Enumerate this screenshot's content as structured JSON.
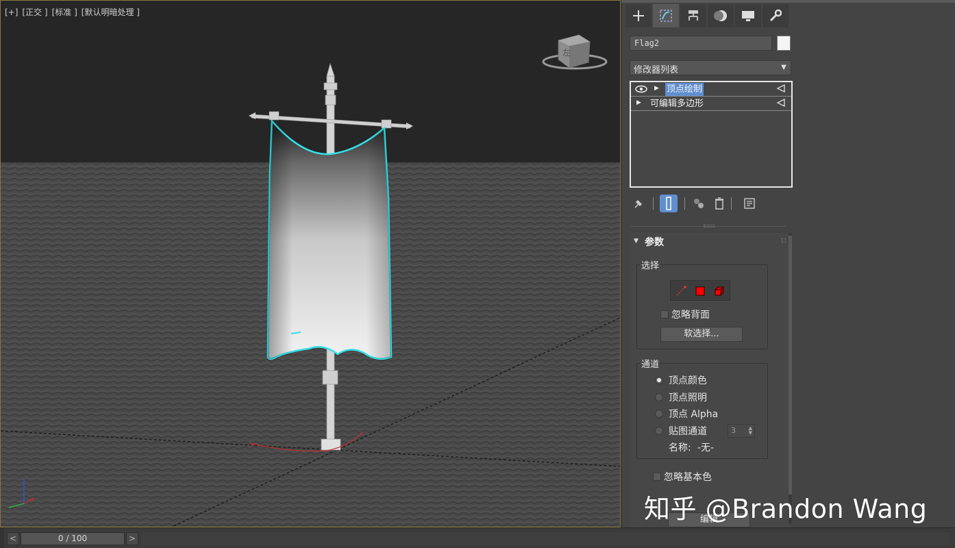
{
  "viewport": {
    "labels": [
      "[+]",
      "[正交 ]",
      "[标准 ]",
      "[默认明暗处理 ]"
    ],
    "viewcube_face": "左",
    "axis_labels": {
      "x": "x",
      "y": "y",
      "z": "z"
    }
  },
  "panel": {
    "tabs": [
      {
        "name": "create-tab",
        "icon": "plus-icon",
        "active": false
      },
      {
        "name": "modify-tab",
        "icon": "modify-icon",
        "active": true
      },
      {
        "name": "hierarchy-tab",
        "icon": "hierarchy-icon",
        "active": false
      },
      {
        "name": "motion-tab",
        "icon": "motion-icon",
        "active": false
      },
      {
        "name": "display-tab",
        "icon": "display-icon",
        "active": false
      },
      {
        "name": "utilities-tab",
        "icon": "wrench-icon",
        "active": false
      }
    ],
    "object_name": "Flag2",
    "object_color": "#f4f4f4",
    "modifier_list": "修改器列表",
    "stack": [
      {
        "label": "顶点绘制",
        "selected": true
      },
      {
        "label": "可编辑多边形",
        "selected": false
      }
    ],
    "params": {
      "title": "参数",
      "selection_group": "选择",
      "ignore_backface": "忽略背面",
      "soft_selection": "软选择...",
      "channel_group": "通道",
      "channels": [
        {
          "label": "顶点颜色",
          "on": true
        },
        {
          "label": "顶点照明",
          "on": false
        },
        {
          "label": "顶点 Alpha",
          "on": false
        },
        {
          "label": "贴图通道",
          "on": false
        }
      ],
      "map_channel_value": "3",
      "name_label": "名称:",
      "name_value": "-无-",
      "ignore_base_color": "忽略基本色",
      "partial_label": "...",
      "edit_button": "编辑"
    }
  },
  "timeline": {
    "prev": "<",
    "frame": "0 / 100",
    "next": ">"
  },
  "watermark": "知乎 @Brandon Wang",
  "colors": {
    "accent": "#5f8fd0",
    "viewport_border": "#8a7a3a",
    "selection_highlight": "#33e0ea"
  }
}
